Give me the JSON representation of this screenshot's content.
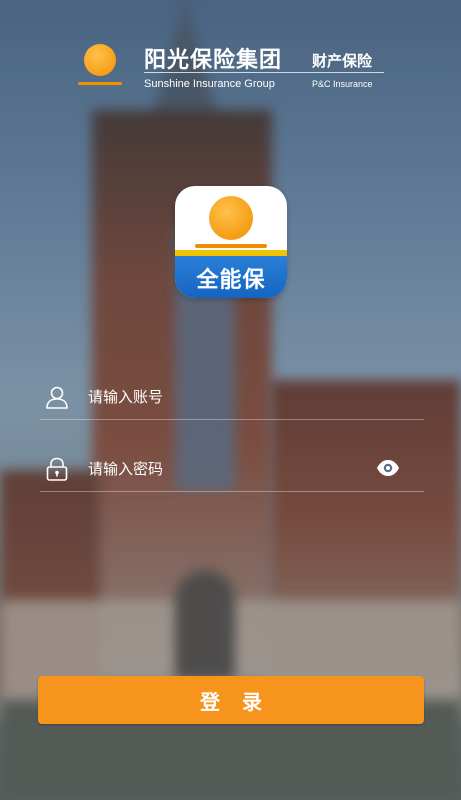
{
  "header": {
    "brand_cn": "阳光保险集团",
    "brand_en": "Sunshine Insurance Group",
    "sub_cn": "财产保险",
    "sub_en": "P&C Insurance"
  },
  "app_icon": {
    "label": "全能保"
  },
  "form": {
    "account": {
      "placeholder": "请输入账号",
      "value": "",
      "icon": "user-icon"
    },
    "password": {
      "placeholder": "请输入密码",
      "value": "",
      "icon": "lock-icon",
      "toggle_icon": "eye-icon"
    }
  },
  "login_button": {
    "label": "登录"
  },
  "colors": {
    "accent": "#f7941d",
    "sun": "#f39000",
    "icon_band": "#1e6fd0"
  }
}
